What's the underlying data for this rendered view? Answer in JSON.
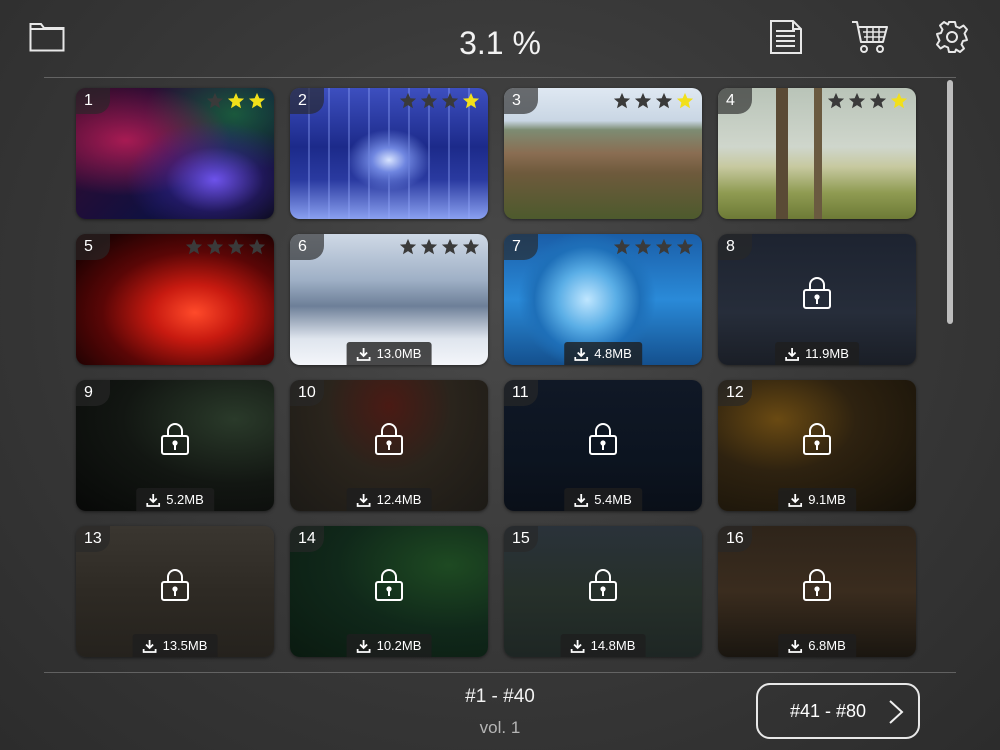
{
  "header": {
    "title": "3.1 %",
    "icons": [
      "folder-icon",
      "document-icon",
      "cart-icon",
      "gear-icon"
    ]
  },
  "grid": {
    "tiles": [
      {
        "num": "1",
        "stars": 2,
        "locked": false,
        "size": ""
      },
      {
        "num": "2",
        "stars": 1,
        "locked": false,
        "size": ""
      },
      {
        "num": "3",
        "stars": 1,
        "locked": false,
        "size": ""
      },
      {
        "num": "4",
        "stars": 1,
        "locked": false,
        "size": ""
      },
      {
        "num": "5",
        "stars": 0,
        "locked": false,
        "size": ""
      },
      {
        "num": "6",
        "stars": 0,
        "locked": false,
        "size": "13.0MB"
      },
      {
        "num": "7",
        "stars": 0,
        "locked": false,
        "size": "4.8MB"
      },
      {
        "num": "8",
        "stars": 0,
        "locked": true,
        "size": "11.9MB"
      },
      {
        "num": "9",
        "stars": 0,
        "locked": true,
        "size": "5.2MB"
      },
      {
        "num": "10",
        "stars": 0,
        "locked": true,
        "size": "12.4MB"
      },
      {
        "num": "11",
        "stars": 0,
        "locked": true,
        "size": "5.4MB"
      },
      {
        "num": "12",
        "stars": 0,
        "locked": true,
        "size": "9.1MB"
      },
      {
        "num": "13",
        "stars": 0,
        "locked": true,
        "size": "13.5MB"
      },
      {
        "num": "14",
        "stars": 0,
        "locked": true,
        "size": "10.2MB"
      },
      {
        "num": "15",
        "stars": 0,
        "locked": true,
        "size": "14.8MB"
      },
      {
        "num": "16",
        "stars": 0,
        "locked": true,
        "size": "6.8MB"
      }
    ]
  },
  "footer": {
    "range": "#1 - #40",
    "volume": "vol. 1",
    "next_label": "#41 - #80"
  },
  "colors": {
    "star_filled": "#f2e01a",
    "star_empty": "#3a3a3a"
  }
}
